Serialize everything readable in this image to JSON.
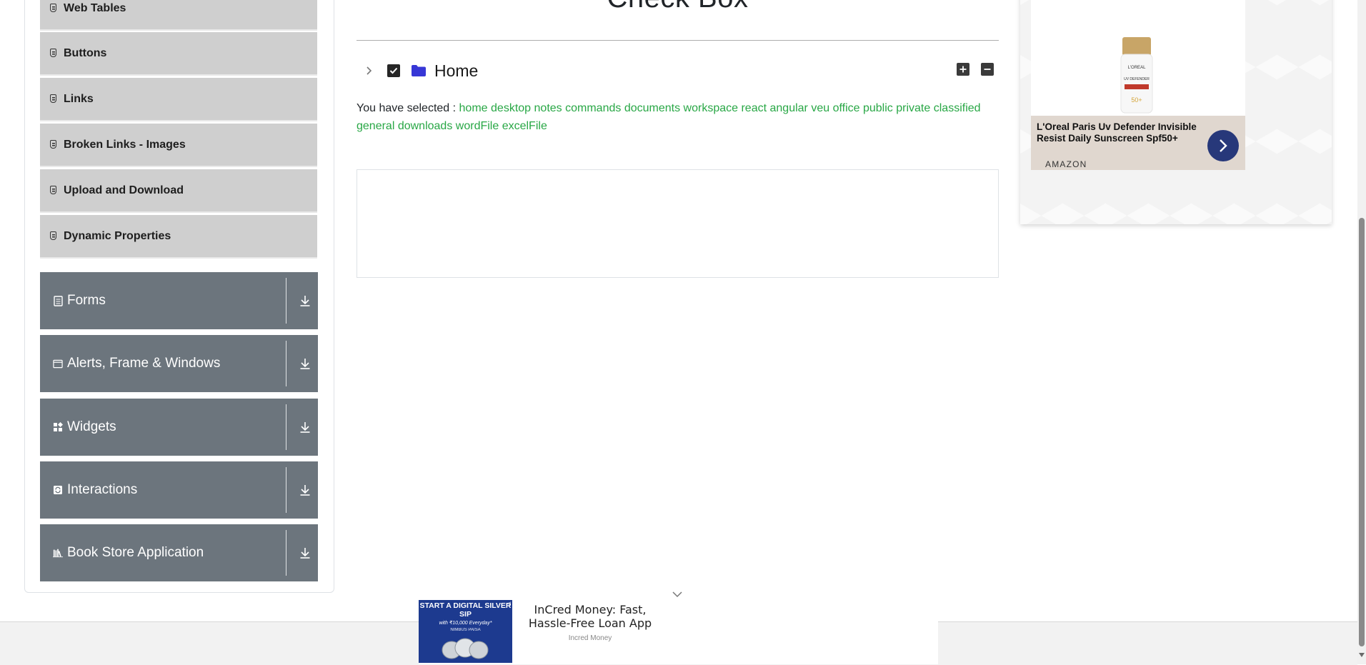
{
  "sidebar": {
    "elements_items": [
      {
        "label": "Web Tables"
      },
      {
        "label": "Buttons"
      },
      {
        "label": "Links"
      },
      {
        "label": "Broken Links - Images"
      },
      {
        "label": "Upload and Download"
      },
      {
        "label": "Dynamic Properties"
      }
    ],
    "groups": [
      {
        "label": "Forms",
        "icon": "form-icon"
      },
      {
        "label": "Alerts, Frame & Windows",
        "icon": "window-icon"
      },
      {
        "label": "Widgets",
        "icon": "widgets-icon"
      },
      {
        "label": "Interactions",
        "icon": "interactions-icon"
      },
      {
        "label": "Book Store Application",
        "icon": "books-icon"
      }
    ]
  },
  "main": {
    "title": "Check Box",
    "tree": {
      "node_label": "Home",
      "checked": true,
      "expand_all_icon": "plus-icon",
      "collapse_all_icon": "minus-icon"
    },
    "result": {
      "prefix": "You have selected :",
      "selected": [
        "home",
        "desktop",
        "notes",
        "commands",
        "documents",
        "workspace",
        "react",
        "angular",
        "veu",
        "office",
        "public",
        "private",
        "classified",
        "general",
        "downloads",
        "wordFile",
        "excelFile"
      ]
    }
  },
  "side_ad": {
    "product_text": "L'Oreal Paris Uv Defender Invisible Resist Daily Sunscreen Spf50+",
    "source": "AMAZON",
    "bottle_brand": "L'OREAL",
    "bottle_label": "UV DEFENDER",
    "bottle_spf": "50+"
  },
  "bottom_ad": {
    "image_title": "START A DIGITAL SILVER SIP",
    "image_subtitle": "with ₹10,000 Everyday*",
    "image_brand": "NIMBUS PAISA",
    "title": "InCred Money: Fast, Hassle-Free Loan App",
    "source": "Incred Money"
  },
  "colors": {
    "sidebar_group_bg": "#6c757d",
    "sidebar_item_bg": "#cfcfcf",
    "selected_text": "#28a745",
    "ad_button": "#27387a"
  }
}
